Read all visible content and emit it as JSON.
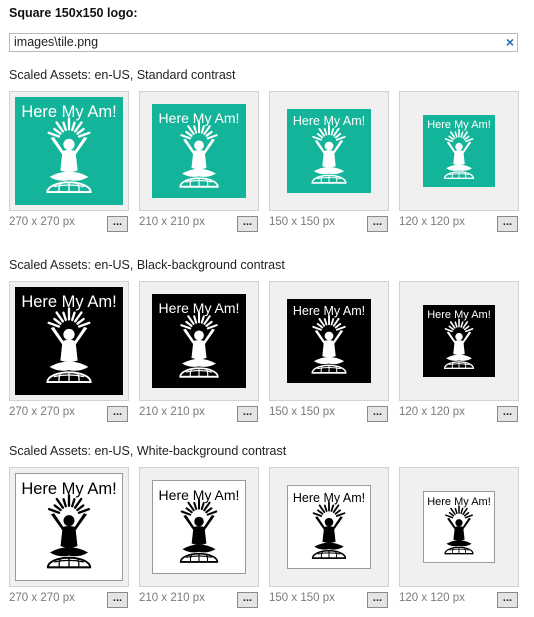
{
  "header": {
    "title": "Square 150x150 logo:",
    "path_value": "images\\tile.png",
    "clear_icon": "×"
  },
  "tile_text": "Here My Am!",
  "button_label": "...",
  "colors": {
    "standard": "#14b49a",
    "black": "#000000",
    "white": "#ffffff",
    "clear_icon": "#1f6fb5"
  },
  "sections": [
    {
      "label": "Scaled Assets: en-US, Standard contrast",
      "variant": "standard",
      "assets": [
        {
          "size_label": "270 x 270 px"
        },
        {
          "size_label": "210 x 210 px"
        },
        {
          "size_label": "150 x 150 px"
        },
        {
          "size_label": "120 x 120 px"
        }
      ]
    },
    {
      "label": "Scaled Assets: en-US, Black-background contrast",
      "variant": "black",
      "assets": [
        {
          "size_label": "270 x 270 px"
        },
        {
          "size_label": "210 x 210 px"
        },
        {
          "size_label": "150 x 150 px"
        },
        {
          "size_label": "120 x 120 px"
        }
      ]
    },
    {
      "label": "Scaled Assets: en-US, White-background contrast",
      "variant": "white",
      "assets": [
        {
          "size_label": "270 x 270 px"
        },
        {
          "size_label": "210 x 210 px"
        },
        {
          "size_label": "150 x 150 px"
        },
        {
          "size_label": "120 x 120 px"
        }
      ]
    }
  ]
}
